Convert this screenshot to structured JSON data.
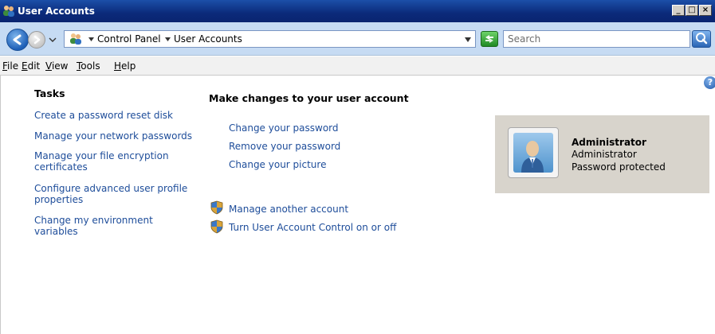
{
  "window": {
    "title": "User Accounts"
  },
  "address_bar": {
    "breadcrumb": [
      "Control Panel",
      "User Accounts"
    ],
    "search_placeholder": "Search"
  },
  "menu": {
    "items": [
      {
        "label": "File",
        "accel": "F",
        "rest": "ile"
      },
      {
        "label": "Edit",
        "accel": "E",
        "rest": "dit"
      },
      {
        "label": "View",
        "accel": "V",
        "rest": "iew"
      },
      {
        "label": "Tools",
        "accel": "T",
        "rest": "ools"
      },
      {
        "label": "Help",
        "accel": "H",
        "rest": "elp"
      }
    ]
  },
  "tasks": {
    "title": "Tasks",
    "links": [
      "Create a password reset disk",
      "Manage your network passwords",
      "Manage your file encryption certificates",
      "Configure advanced user profile properties",
      "Change my environment variables"
    ]
  },
  "main": {
    "heading": "Make changes to your user account",
    "links": [
      "Change your password",
      "Remove your password",
      "Change your picture"
    ],
    "shield_links": [
      "Manage another account",
      "Turn User Account Control on or off"
    ]
  },
  "account": {
    "name": "Administrator",
    "type": "Administrator",
    "status": "Password protected"
  },
  "icons": {
    "app": "user-accounts-icon",
    "back": "back-arrow-icon",
    "forward": "forward-arrow-icon",
    "refresh": "refresh-icon",
    "search": "search-icon",
    "help": "help-icon",
    "shield": "uac-shield-icon"
  }
}
